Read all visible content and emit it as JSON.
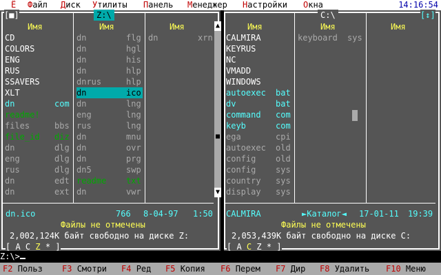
{
  "menu": {
    "items": [
      {
        "hotkey": "Ё",
        "rest": ""
      },
      {
        "hotkey": "Ф",
        "rest": "айл"
      },
      {
        "hotkey": "Д",
        "rest": "иск"
      },
      {
        "hotkey": "У",
        "rest": "тилиты"
      },
      {
        "hotkey": "П",
        "rest": "анель"
      },
      {
        "hotkey": "М",
        "rest": "енеджер"
      },
      {
        "hotkey": "Н",
        "rest": "астройки"
      },
      {
        "hotkey": "О",
        "rest": "кна"
      }
    ],
    "clock": "14:16:54"
  },
  "left_panel": {
    "title": "Z:\\",
    "close_marker": "[■]",
    "column_header": "Имя",
    "columns": [
      [
        {
          "name": "CD",
          "ext": "",
          "color": "#ffffff"
        },
        {
          "name": "COLORS",
          "ext": "",
          "color": "#ffffff"
        },
        {
          "name": "ENG",
          "ext": "",
          "color": "#ffffff"
        },
        {
          "name": "RUS",
          "ext": "",
          "color": "#ffffff"
        },
        {
          "name": "SSAVERS",
          "ext": "",
          "color": "#ffffff"
        },
        {
          "name": "XLT",
          "ext": "",
          "color": "#ffffff"
        },
        {
          "name": "dn",
          "ext": "com",
          "color": "#55ffff"
        },
        {
          "name": "readme!",
          "ext": "",
          "color": "#00aa00"
        },
        {
          "name": "files",
          "ext": "bbs",
          "color": "#aaaaaa"
        },
        {
          "name": "file_id",
          "ext": "diz",
          "color": "#00aa00"
        },
        {
          "name": "dn",
          "ext": "dlg",
          "color": "#aaaaaa"
        },
        {
          "name": "eng",
          "ext": "dlg",
          "color": "#aaaaaa"
        },
        {
          "name": "rus",
          "ext": "dlg",
          "color": "#aaaaaa"
        },
        {
          "name": "dn",
          "ext": "edt",
          "color": "#aaaaaa"
        },
        {
          "name": "dn",
          "ext": "ext",
          "color": "#aaaaaa"
        }
      ],
      [
        {
          "name": "dn",
          "ext": "flg",
          "color": "#aaaaaa"
        },
        {
          "name": "dn",
          "ext": "hgl",
          "color": "#aaaaaa"
        },
        {
          "name": "dn",
          "ext": "his",
          "color": "#aaaaaa"
        },
        {
          "name": "dn",
          "ext": "hlp",
          "color": "#aaaaaa"
        },
        {
          "name": "dnrus",
          "ext": "hlp",
          "color": "#aaaaaa"
        },
        {
          "name": "dn",
          "ext": "ico",
          "color": "#000000",
          "selected": true
        },
        {
          "name": "dn",
          "ext": "lng",
          "color": "#aaaaaa"
        },
        {
          "name": "eng",
          "ext": "lng",
          "color": "#aaaaaa"
        },
        {
          "name": "rus",
          "ext": "lng",
          "color": "#aaaaaa"
        },
        {
          "name": "dn",
          "ext": "mnu",
          "color": "#aaaaaa"
        },
        {
          "name": "dn",
          "ext": "ovr",
          "color": "#aaaaaa"
        },
        {
          "name": "dn",
          "ext": "prg",
          "color": "#aaaaaa"
        },
        {
          "name": "dn5",
          "ext": "swp",
          "color": "#aaaaaa"
        },
        {
          "name": "readme",
          "ext": "txt",
          "color": "#00aa00"
        },
        {
          "name": "dn",
          "ext": "vwr",
          "color": "#aaaaaa"
        }
      ],
      [
        {
          "name": "dn",
          "ext": "xrn",
          "color": "#aaaaaa"
        }
      ]
    ],
    "status_file": "dn.ico",
    "status_size": "766",
    "status_date": "8-04-97",
    "status_time": "1:50",
    "no_selection": "Файлы не отмечены",
    "free_space": "2,002,124K байт свободно на диске Z:",
    "drives": [
      "A",
      "C",
      "Z",
      "*"
    ],
    "current_drive": "Z"
  },
  "right_panel": {
    "title": "C:\\",
    "zoom_marker": "[↕]",
    "column_header": "Имя",
    "columns": [
      [
        {
          "name": "CALMIRA",
          "ext": "",
          "color": "#ffffff"
        },
        {
          "name": "KEYRUS",
          "ext": "",
          "color": "#ffffff"
        },
        {
          "name": "NC",
          "ext": "",
          "color": "#ffffff"
        },
        {
          "name": "VMADD",
          "ext": "",
          "color": "#ffffff"
        },
        {
          "name": "WINDOWS",
          "ext": "",
          "color": "#ffffff"
        },
        {
          "name": "autoexec",
          "ext": "bat",
          "color": "#55ffff"
        },
        {
          "name": "dv",
          "ext": "bat",
          "color": "#55ffff"
        },
        {
          "name": "command",
          "ext": "com",
          "color": "#55ffff"
        },
        {
          "name": "keyb",
          "ext": "com",
          "color": "#55ffff"
        },
        {
          "name": "ega",
          "ext": "cpi",
          "color": "#aaaaaa"
        },
        {
          "name": "autoexec",
          "ext": "old",
          "color": "#aaaaaa"
        },
        {
          "name": "config",
          "ext": "old",
          "color": "#aaaaaa"
        },
        {
          "name": "config",
          "ext": "sys",
          "color": "#aaaaaa"
        },
        {
          "name": "country",
          "ext": "sys",
          "color": "#aaaaaa"
        },
        {
          "name": "display",
          "ext": "sys",
          "color": "#aaaaaa"
        }
      ],
      [
        {
          "name": "keyboard",
          "ext": "sys",
          "color": "#aaaaaa"
        }
      ],
      []
    ],
    "status_file": "CALMIRA",
    "status_size": "►Каталог◄",
    "status_date": "17-01-11",
    "status_time": "19:39",
    "no_selection": "Файлы не отмечены",
    "free_space": "2,053,439K байт свободно на диске C:",
    "drives": [
      "A",
      "C",
      "Z",
      "*"
    ],
    "current_drive": "C"
  },
  "command_line": "Z:\\>",
  "function_keys": [
    {
      "num": "F2",
      "label": "Польз"
    },
    {
      "num": "F3",
      "label": "Смотри"
    },
    {
      "num": "F4",
      "label": "Ред"
    },
    {
      "num": "F5",
      "label": "Копия"
    },
    {
      "num": "F6",
      "label": "Перем"
    },
    {
      "num": "F7",
      "label": "Дир"
    },
    {
      "num": "F8",
      "label": "Удалить"
    },
    {
      "num": "F10",
      "label": "Меню"
    }
  ],
  "scroll_arrows": {
    "up": "▲",
    "down": "▼",
    "thumb": "■"
  }
}
